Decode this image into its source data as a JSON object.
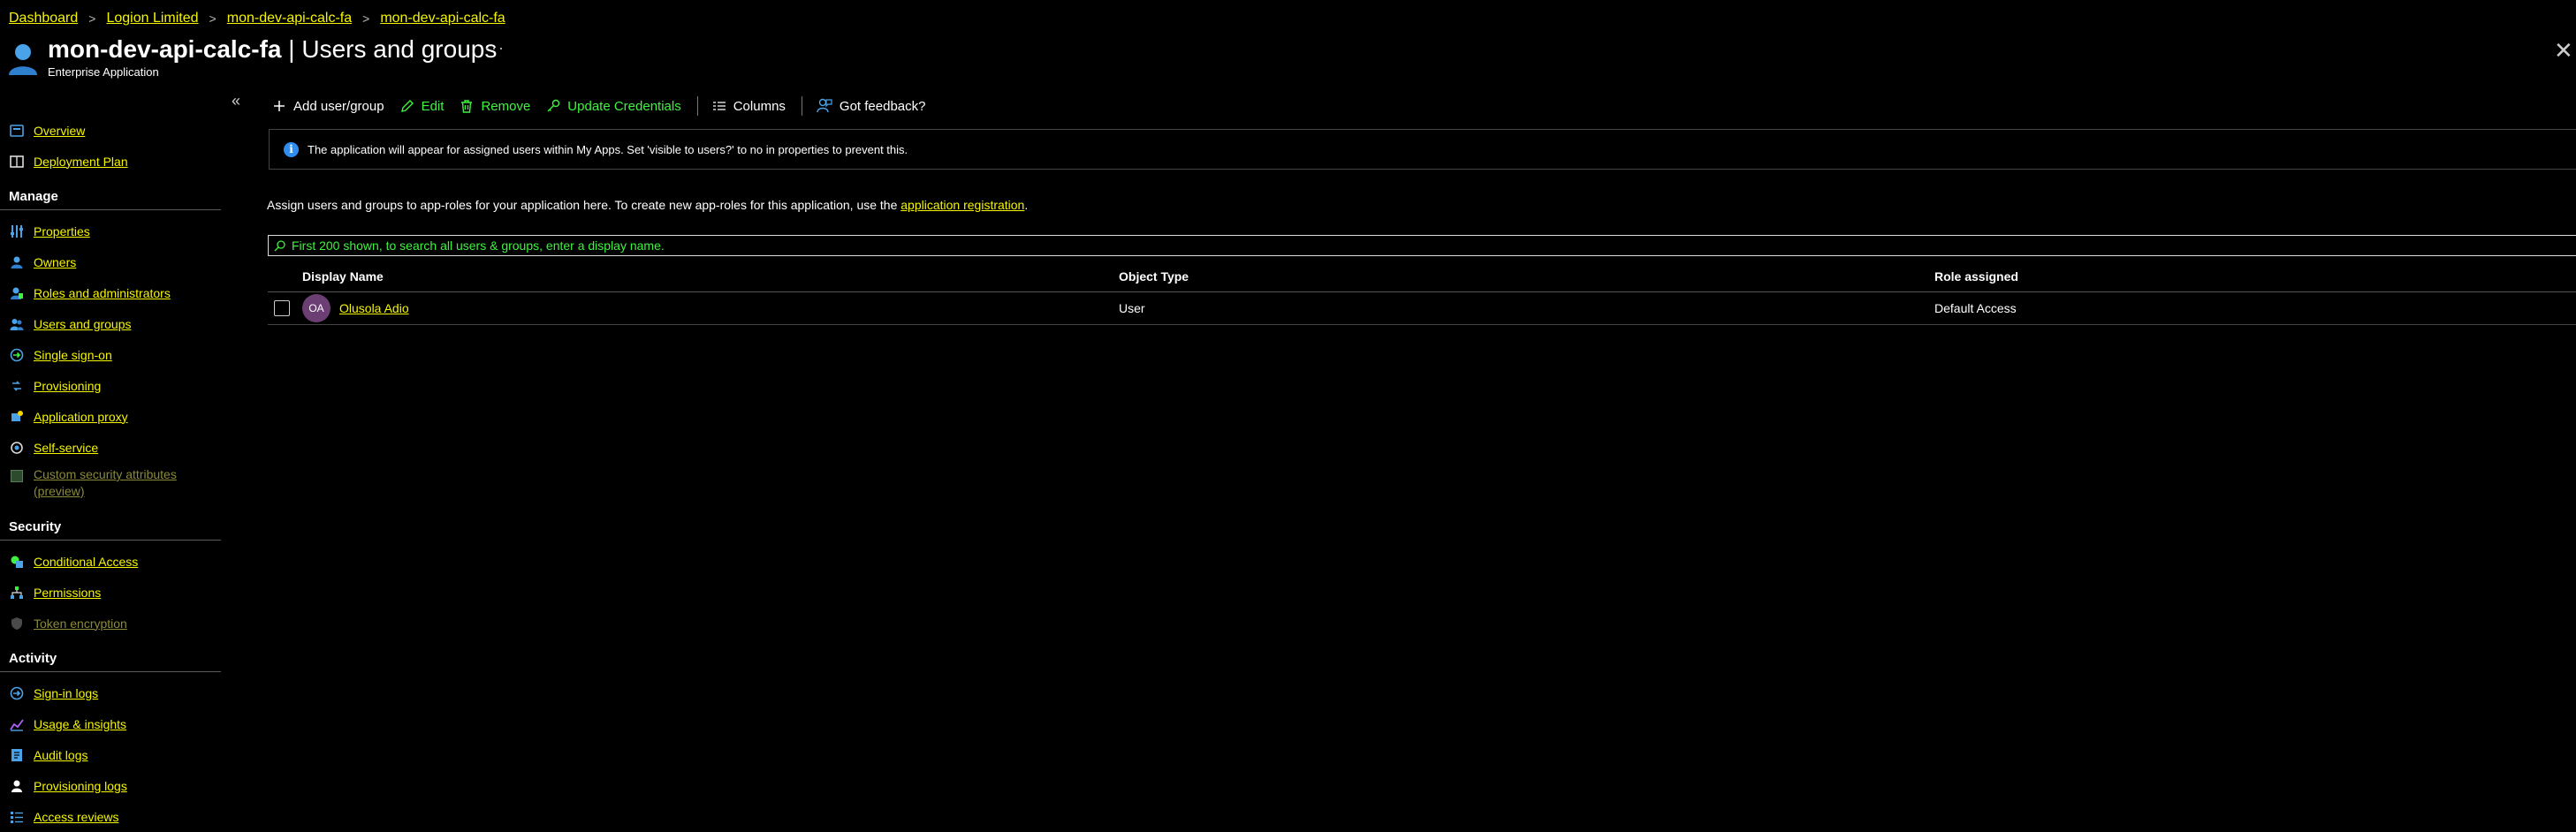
{
  "breadcrumb": {
    "items": [
      "Dashboard",
      "Logion Limited",
      "mon-dev-api-calc-fa",
      "mon-dev-api-calc-fa"
    ]
  },
  "header": {
    "app_name": "mon-dev-api-calc-fa",
    "separator": " | ",
    "page_name": "Users and groups",
    "subtitle": "Enterprise Application",
    "more": "···",
    "close": "✕"
  },
  "sidebar": {
    "collapse": "«",
    "top_items": [
      {
        "label": "Overview",
        "icon": "overview-icon"
      },
      {
        "label": "Deployment Plan",
        "icon": "book-icon"
      }
    ],
    "sections": [
      {
        "title": "Manage",
        "items": [
          {
            "label": "Properties",
            "icon": "properties-icon"
          },
          {
            "label": "Owners",
            "icon": "owners-icon"
          },
          {
            "label": "Roles and administrators",
            "icon": "roles-icon"
          },
          {
            "label": "Users and groups",
            "icon": "users-icon"
          },
          {
            "label": "Single sign-on",
            "icon": "sso-icon"
          },
          {
            "label": "Provisioning",
            "icon": "provisioning-icon"
          },
          {
            "label": "Application proxy",
            "icon": "app-proxy-icon"
          },
          {
            "label": "Self-service",
            "icon": "self-service-icon"
          },
          {
            "label": "Custom security attributes (preview)",
            "icon": "custom-attributes-icon",
            "disabled": true
          }
        ]
      },
      {
        "title": "Security",
        "items": [
          {
            "label": "Conditional Access",
            "icon": "conditional-access-icon"
          },
          {
            "label": "Permissions",
            "icon": "permissions-icon"
          },
          {
            "label": "Token encryption",
            "icon": "shield-icon",
            "disabled": true
          }
        ]
      },
      {
        "title": "Activity",
        "items": [
          {
            "label": "Sign-in logs",
            "icon": "sign-in-icon"
          },
          {
            "label": "Usage & insights",
            "icon": "chart-icon"
          },
          {
            "label": "Audit logs",
            "icon": "audit-icon"
          },
          {
            "label": "Provisioning logs",
            "icon": "provisioning-logs-icon"
          },
          {
            "label": "Access reviews",
            "icon": "list-icon"
          }
        ]
      }
    ]
  },
  "toolbar": {
    "add": "Add user/group",
    "edit": "Edit",
    "remove": "Remove",
    "update_credentials": "Update Credentials",
    "columns": "Columns",
    "feedback": "Got feedback?"
  },
  "info": {
    "icon": "i",
    "text": "The application will appear for assigned users within My Apps. Set 'visible to users?' to no in properties to prevent this."
  },
  "assign": {
    "text": "Assign users and groups to app-roles for your application here. To create new app-roles for this application, use the ",
    "link": "application registration",
    "end": "."
  },
  "search": {
    "placeholder": "First 200 shown, to search all users & groups, enter a display name."
  },
  "table": {
    "headers": [
      "Display Name",
      "Object Type",
      "Role assigned"
    ],
    "rows": [
      {
        "initials": "OA",
        "name": "Olusola Adio",
        "type": "User",
        "role": "Default Access"
      }
    ]
  },
  "colors": {
    "link": "#f5f500",
    "action_green": "#3ff23f",
    "info_blue": "#2f8df0",
    "avatar": "#6b3e74"
  }
}
